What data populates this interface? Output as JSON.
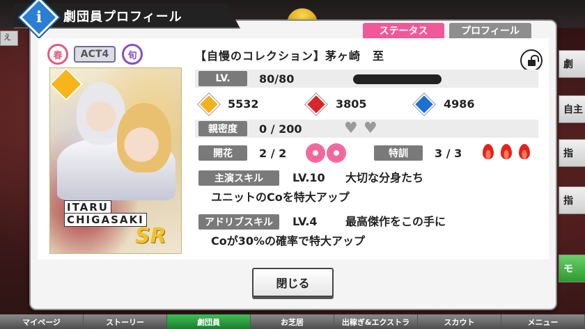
{
  "window": {
    "title": "劇団員プロフィール",
    "info_icon": "i"
  },
  "tabs": {
    "status": "ステータス",
    "profile": "プロフィール"
  },
  "badges": {
    "season": "春",
    "act": "ACT4",
    "shun": "旬"
  },
  "card": {
    "name_line1": "ITARU",
    "name_line2": "CHIGASAKI",
    "rarity": "SR",
    "attribute_icon": "gold-diamond-icon"
  },
  "character": {
    "title": "【自慢のコレクション】茅ヶ崎　至"
  },
  "level": {
    "label": "LV.",
    "value": "80/80"
  },
  "stats": {
    "gold": "5532",
    "red": "3805",
    "blue": "4986",
    "colors": {
      "gold": "#f2b21b",
      "red": "#d8262a",
      "blue": "#1e6fd4"
    }
  },
  "intimacy": {
    "label": "親密度",
    "value": "0 / 200"
  },
  "bloom": {
    "label": "開花",
    "value": "2 / 2"
  },
  "training": {
    "label": "特訓",
    "value": "3 / 3"
  },
  "lead_skill": {
    "label": "主演スキル",
    "level": "LV.10",
    "name": "大切な分身たち",
    "description": "ユニットのCoを特大アップ"
  },
  "adlib_skill": {
    "label": "アドリブスキル",
    "level": "LV.4",
    "name": "最高傑作をこの手に",
    "description": "Coが30%の確率で特大アップ"
  },
  "close_button": "閉じる",
  "bottom_nav": [
    "マイページ",
    "ストーリー",
    "劇団員",
    "お芝居",
    "出稼ぎ&エクストラ",
    "スカウト",
    "メニュー"
  ],
  "background": {
    "left_label": "え",
    "right_labels": [
      "劇",
      "自主",
      "指",
      "指",
      "モ"
    ]
  }
}
